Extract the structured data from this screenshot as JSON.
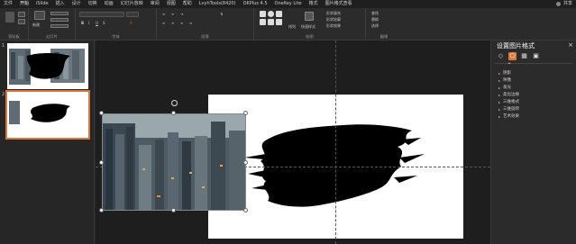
{
  "menu": {
    "tabs": [
      "文件",
      "开始",
      "iSlide",
      "插入",
      "设计",
      "切换",
      "动画",
      "幻灯片放映",
      "审阅",
      "视图",
      "帮助",
      "LvyhTools(8420)",
      "OKPlus 4.5",
      "OneKey Lite",
      "格式",
      "图片格式查看"
    ],
    "active_index": 1,
    "user_label": "共享"
  },
  "ribbon": {
    "groups": [
      {
        "label": "剪贴板"
      },
      {
        "label": "幻灯片"
      },
      {
        "label": "字体"
      },
      {
        "label": "段落"
      },
      {
        "label": "绘图"
      },
      {
        "label": "编辑"
      }
    ],
    "buttons": {
      "new_slide": "新建",
      "arrange": "排列",
      "quick_styles": "快速样式",
      "shape_fill": "形状填充",
      "shape_outline": "形状轮廓",
      "shape_effect": "形状效果",
      "find": "查找",
      "replace": "替换",
      "select": "选择"
    }
  },
  "slides": [
    {
      "number": "1"
    },
    {
      "number": "2",
      "selected": true
    }
  ],
  "pane": {
    "title": "设置图片格式",
    "close_icon": "×",
    "sections": [
      "阴影",
      "映像",
      "发光",
      "柔化边缘",
      "三维格式",
      "三维旋转",
      "艺术效果"
    ]
  },
  "colors": {
    "accent": "#d9773a",
    "background": "#262626",
    "ribbon": "#2b2b2b"
  }
}
